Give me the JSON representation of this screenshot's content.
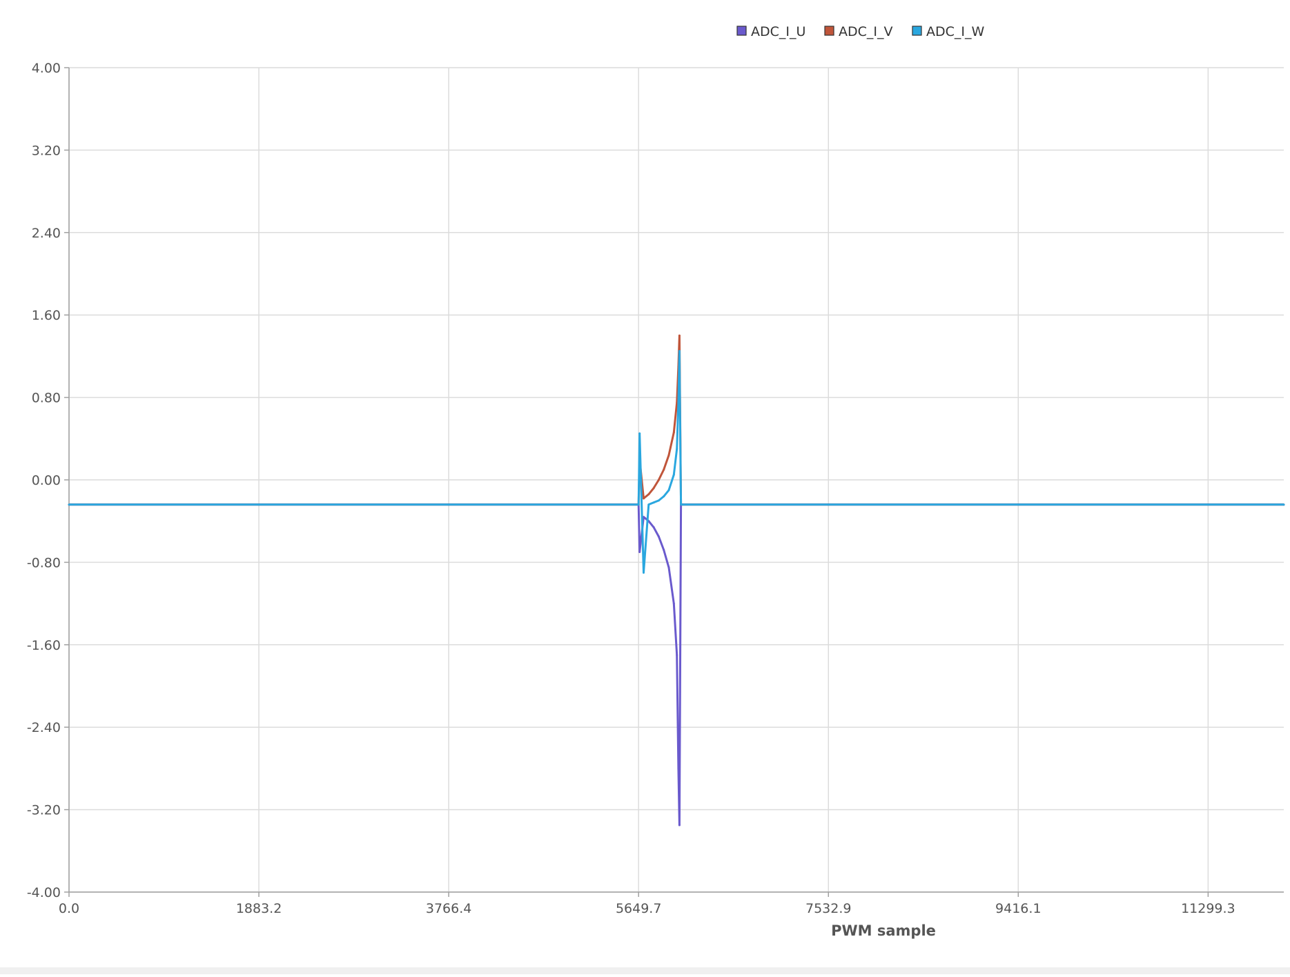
{
  "chart_data": {
    "type": "line",
    "title": "",
    "xlabel": "PWM sample",
    "ylabel": "",
    "xlim": [
      0,
      12050
    ],
    "ylim": [
      -4.0,
      4.0
    ],
    "x_ticks": [
      0.0,
      1883.2,
      3766.4,
      5649.7,
      7532.9,
      9416.1,
      11299.3
    ],
    "x_tick_labels": [
      "0.0",
      "1883.2",
      "3766.4",
      "5649.7",
      "7532.9",
      "9416.1",
      "11299.3"
    ],
    "y_ticks": [
      4.0,
      3.2,
      2.4,
      1.6,
      0.8,
      0.0,
      -0.8,
      -1.6,
      -2.4,
      -3.2,
      -4.0
    ],
    "y_tick_labels": [
      "4.00",
      "3.20",
      "2.40",
      "1.60",
      "0.80",
      "0.00",
      "-0.80",
      "-1.60",
      "-2.40",
      "-3.20",
      "-4.00"
    ],
    "grid": true,
    "legend_position": "top-center",
    "series": [
      {
        "name": "ADC_I_U",
        "color": "#6a5acd",
        "x": [
          0,
          1883.2,
          3766.4,
          5649.7,
          5660,
          5700,
          5750,
          5800,
          5850,
          5900,
          5950,
          6000,
          6030,
          6045,
          6055,
          6070,
          7532.9,
          9416.1,
          11299.3,
          12050
        ],
        "y": [
          -0.24,
          -0.24,
          -0.24,
          -0.24,
          -0.7,
          -0.36,
          -0.4,
          -0.46,
          -0.55,
          -0.68,
          -0.85,
          -1.2,
          -1.7,
          -2.8,
          -3.35,
          -0.24,
          -0.24,
          -0.24,
          -0.24,
          -0.24
        ]
      },
      {
        "name": "ADC_I_V",
        "color": "#c0553a",
        "x": [
          0,
          1883.2,
          3766.4,
          5649.7,
          5660,
          5700,
          5750,
          5800,
          5850,
          5900,
          5950,
          6000,
          6030,
          6045,
          6055,
          6070,
          7532.9,
          9416.1,
          11299.3,
          12050
        ],
        "y": [
          -0.24,
          -0.24,
          -0.24,
          -0.24,
          0.2,
          -0.18,
          -0.14,
          -0.08,
          0.0,
          0.1,
          0.24,
          0.46,
          0.75,
          1.1,
          1.4,
          -0.24,
          -0.24,
          -0.24,
          -0.24,
          -0.24
        ]
      },
      {
        "name": "ADC_I_W",
        "color": "#2aa7df",
        "x": [
          0,
          1883.2,
          3766.4,
          5649.7,
          5660,
          5700,
          5750,
          5800,
          5850,
          5900,
          5950,
          6000,
          6030,
          6045,
          6055,
          6070,
          7532.9,
          9416.1,
          11299.3,
          12050
        ],
        "y": [
          -0.24,
          -0.24,
          -0.24,
          -0.24,
          0.45,
          -0.9,
          -0.24,
          -0.22,
          -0.2,
          -0.16,
          -0.1,
          0.05,
          0.3,
          0.75,
          1.25,
          -0.24,
          -0.24,
          -0.24,
          -0.24,
          -0.24
        ]
      }
    ]
  }
}
